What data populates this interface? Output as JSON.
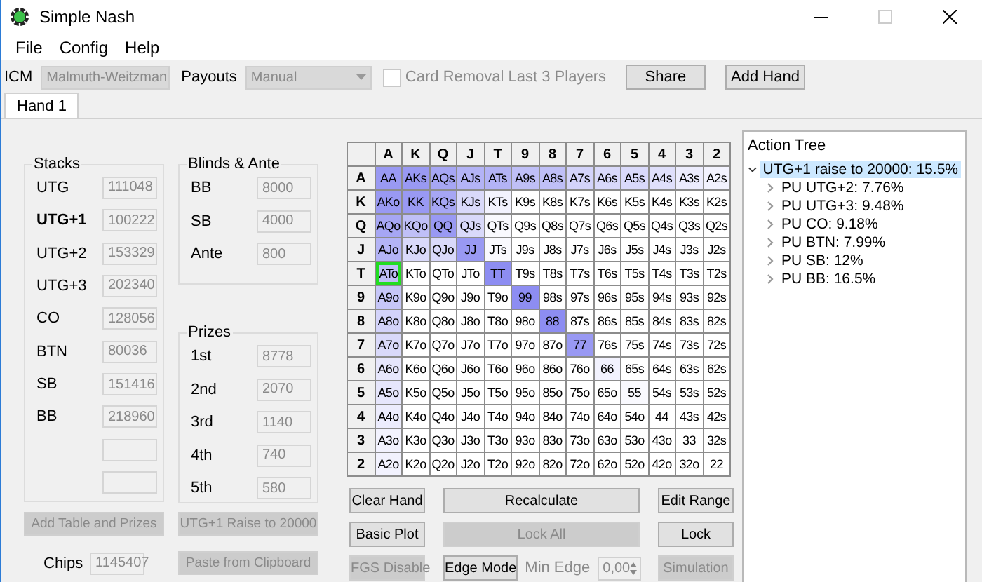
{
  "window": {
    "title": "Simple Nash"
  },
  "menu": [
    "File",
    "Config",
    "Help"
  ],
  "toolbar": {
    "icm_label": "ICM",
    "icm": {
      "value": "Malmuth-Weitzman",
      "disabled": true
    },
    "payouts_label": "Payouts",
    "payouts": {
      "value": "Manual",
      "disabled": true
    },
    "card_removal": {
      "label": "Card Removal Last 3 Players",
      "checked": false,
      "disabled": true
    },
    "buttons": [
      {
        "label": "Share",
        "disabled": false
      },
      {
        "label": "Add Hand",
        "disabled": false
      }
    ]
  },
  "tabs": [
    {
      "label": "Hand 1",
      "selected": true
    }
  ],
  "stacks": {
    "title": "Stacks",
    "rows": [
      {
        "kind": "player",
        "position": "UTG",
        "value": "111048",
        "active": false
      },
      {
        "kind": "player",
        "position": "UTG+1",
        "value": "100222",
        "active": true
      },
      {
        "kind": "player",
        "position": "UTG+2",
        "value": "153329",
        "active": false
      },
      {
        "kind": "player",
        "position": "UTG+3",
        "value": "202340",
        "active": false
      },
      {
        "kind": "player",
        "position": "CO",
        "value": "128056",
        "active": false
      },
      {
        "kind": "player",
        "position": "BTN",
        "value": "80036",
        "active": false
      },
      {
        "kind": "player",
        "position": "SB",
        "value": "151416",
        "active": false
      },
      {
        "kind": "player",
        "position": "BB",
        "value": "218960",
        "active": false
      },
      {
        "kind": "blank"
      },
      {
        "kind": "blank"
      }
    ]
  },
  "blinds": {
    "title": "Blinds & Ante",
    "rows": [
      {
        "label": "BB",
        "value": "8000"
      },
      {
        "label": "SB",
        "value": "4000"
      },
      {
        "label": "Ante",
        "value": "800"
      }
    ]
  },
  "prizes": {
    "title": "Prizes",
    "rows": [
      {
        "label": "1st",
        "value": "8778"
      },
      {
        "label": "2nd",
        "value": "2070"
      },
      {
        "label": "3rd",
        "value": "1140"
      },
      {
        "label": "4th",
        "value": "740"
      },
      {
        "label": "5th",
        "value": "580"
      }
    ]
  },
  "left_buttons": [
    {
      "label": "Add Table and Prizes",
      "disabled": true
    },
    {
      "label": "UTG+1 Raise to 20000",
      "disabled": true
    }
  ],
  "chips": {
    "label": "Chips",
    "value": "1145407"
  },
  "paste_button": {
    "label": "Paste from Clipboard",
    "disabled": true
  },
  "grid": {
    "columns": [
      "A",
      "K",
      "Q",
      "J",
      "T",
      "9",
      "8",
      "7",
      "6",
      "5",
      "4",
      "3",
      "2"
    ],
    "rows": [
      {
        "label": "A",
        "cells": [
          {
            "label": "AA",
            "color": "#9999f3",
            "selected": false
          },
          {
            "label": "AKs",
            "color": "#9999f3",
            "selected": false
          },
          {
            "label": "AQs",
            "color": "#a6a6f4",
            "selected": false
          },
          {
            "label": "AJs",
            "color": "#b3b3f6",
            "selected": false
          },
          {
            "label": "ATs",
            "color": "#b3b3f6",
            "selected": false
          },
          {
            "label": "A9s",
            "color": "#bfbff7",
            "selected": false
          },
          {
            "label": "A8s",
            "color": "#bfbff7",
            "selected": false
          },
          {
            "label": "A7s",
            "color": "#d3d3fa",
            "selected": false
          },
          {
            "label": "A6s",
            "color": "#d9d9fa",
            "selected": false
          },
          {
            "label": "A5s",
            "color": "#d9d9fa",
            "selected": false
          },
          {
            "label": "A4s",
            "color": "#dfdffb",
            "selected": false
          },
          {
            "label": "A3s",
            "color": "#ececfd",
            "selected": false
          },
          {
            "label": "A2s",
            "color": "#f2f2fe",
            "selected": false
          }
        ]
      },
      {
        "label": "K",
        "cells": [
          {
            "label": "AKo",
            "color": "#9999f3",
            "selected": false
          },
          {
            "label": "KK",
            "color": "#9999f3",
            "selected": false
          },
          {
            "label": "KQs",
            "color": "#a6a6f4",
            "selected": false
          },
          {
            "label": "KJs",
            "color": "#d9d9fa",
            "selected": false
          },
          {
            "label": "KTs",
            "color": "#f2f2fe",
            "selected": false
          },
          {
            "label": "K9s",
            "color": "#ffffff",
            "selected": false
          },
          {
            "label": "K8s",
            "color": "#ffffff",
            "selected": false
          },
          {
            "label": "K7s",
            "color": "#ffffff",
            "selected": false
          },
          {
            "label": "K6s",
            "color": "#ffffff",
            "selected": false
          },
          {
            "label": "K5s",
            "color": "#ffffff",
            "selected": false
          },
          {
            "label": "K4s",
            "color": "#ffffff",
            "selected": false
          },
          {
            "label": "K3s",
            "color": "#ffffff",
            "selected": false
          },
          {
            "label": "K2s",
            "color": "#ffffff",
            "selected": false
          }
        ]
      },
      {
        "label": "Q",
        "cells": [
          {
            "label": "AQo",
            "color": "#a6a6f4",
            "selected": false
          },
          {
            "label": "KQo",
            "color": "#bfbff7",
            "selected": false
          },
          {
            "label": "QQ",
            "color": "#9999f3",
            "selected": false
          },
          {
            "label": "QJs",
            "color": "#d9d9fa",
            "selected": false
          },
          {
            "label": "QTs",
            "color": "#f9f9fe",
            "selected": false
          },
          {
            "label": "Q9s",
            "color": "#ffffff",
            "selected": false
          },
          {
            "label": "Q8s",
            "color": "#ffffff",
            "selected": false
          },
          {
            "label": "Q7s",
            "color": "#ffffff",
            "selected": false
          },
          {
            "label": "Q6s",
            "color": "#ffffff",
            "selected": false
          },
          {
            "label": "Q5s",
            "color": "#ffffff",
            "selected": false
          },
          {
            "label": "Q4s",
            "color": "#ffffff",
            "selected": false
          },
          {
            "label": "Q3s",
            "color": "#ffffff",
            "selected": false
          },
          {
            "label": "Q2s",
            "color": "#ffffff",
            "selected": false
          }
        ]
      },
      {
        "label": "J",
        "cells": [
          {
            "label": "AJo",
            "color": "#b3b3f6",
            "selected": false
          },
          {
            "label": "KJo",
            "color": "#d9d9fa",
            "selected": false
          },
          {
            "label": "QJo",
            "color": "#d9d9fa",
            "selected": false
          },
          {
            "label": "JJ",
            "color": "#9999f3",
            "selected": false
          },
          {
            "label": "JTs",
            "color": "#f9f9fe",
            "selected": false
          },
          {
            "label": "J9s",
            "color": "#ffffff",
            "selected": false
          },
          {
            "label": "J8s",
            "color": "#ffffff",
            "selected": false
          },
          {
            "label": "J7s",
            "color": "#ffffff",
            "selected": false
          },
          {
            "label": "J6s",
            "color": "#ffffff",
            "selected": false
          },
          {
            "label": "J5s",
            "color": "#ffffff",
            "selected": false
          },
          {
            "label": "J4s",
            "color": "#ffffff",
            "selected": false
          },
          {
            "label": "J3s",
            "color": "#ffffff",
            "selected": false
          },
          {
            "label": "J2s",
            "color": "#ffffff",
            "selected": false
          }
        ]
      },
      {
        "label": "T",
        "cells": [
          {
            "label": "ATo",
            "color": "#bfbff7",
            "selected": true
          },
          {
            "label": "KTo",
            "color": "#ffffff",
            "selected": false
          },
          {
            "label": "QTo",
            "color": "#ffffff",
            "selected": false
          },
          {
            "label": "JTo",
            "color": "#ffffff",
            "selected": false
          },
          {
            "label": "TT",
            "color": "#8d8df2",
            "selected": false
          },
          {
            "label": "T9s",
            "color": "#ffffff",
            "selected": false
          },
          {
            "label": "T8s",
            "color": "#ffffff",
            "selected": false
          },
          {
            "label": "T7s",
            "color": "#ffffff",
            "selected": false
          },
          {
            "label": "T6s",
            "color": "#ffffff",
            "selected": false
          },
          {
            "label": "T5s",
            "color": "#ffffff",
            "selected": false
          },
          {
            "label": "T4s",
            "color": "#ffffff",
            "selected": false
          },
          {
            "label": "T3s",
            "color": "#ffffff",
            "selected": false
          },
          {
            "label": "T2s",
            "color": "#ffffff",
            "selected": false
          }
        ]
      },
      {
        "label": "9",
        "cells": [
          {
            "label": "A9o",
            "color": "#c6c6f8",
            "selected": false
          },
          {
            "label": "K9o",
            "color": "#ffffff",
            "selected": false
          },
          {
            "label": "Q9o",
            "color": "#ffffff",
            "selected": false
          },
          {
            "label": "J9o",
            "color": "#ffffff",
            "selected": false
          },
          {
            "label": "T9o",
            "color": "#ffffff",
            "selected": false
          },
          {
            "label": "99",
            "color": "#8d8df2",
            "selected": false
          },
          {
            "label": "98s",
            "color": "#ffffff",
            "selected": false
          },
          {
            "label": "97s",
            "color": "#ffffff",
            "selected": false
          },
          {
            "label": "96s",
            "color": "#ffffff",
            "selected": false
          },
          {
            "label": "95s",
            "color": "#ffffff",
            "selected": false
          },
          {
            "label": "94s",
            "color": "#ffffff",
            "selected": false
          },
          {
            "label": "93s",
            "color": "#ffffff",
            "selected": false
          },
          {
            "label": "92s",
            "color": "#ffffff",
            "selected": false
          }
        ]
      },
      {
        "label": "8",
        "cells": [
          {
            "label": "A8o",
            "color": "#d3d3fa",
            "selected": false
          },
          {
            "label": "K8o",
            "color": "#ffffff",
            "selected": false
          },
          {
            "label": "Q8o",
            "color": "#ffffff",
            "selected": false
          },
          {
            "label": "J8o",
            "color": "#ffffff",
            "selected": false
          },
          {
            "label": "T8o",
            "color": "#ffffff",
            "selected": false
          },
          {
            "label": "98o",
            "color": "#ffffff",
            "selected": false
          },
          {
            "label": "88",
            "color": "#8d8df2",
            "selected": false
          },
          {
            "label": "87s",
            "color": "#ffffff",
            "selected": false
          },
          {
            "label": "86s",
            "color": "#ffffff",
            "selected": false
          },
          {
            "label": "85s",
            "color": "#ffffff",
            "selected": false
          },
          {
            "label": "84s",
            "color": "#ffffff",
            "selected": false
          },
          {
            "label": "83s",
            "color": "#ffffff",
            "selected": false
          },
          {
            "label": "82s",
            "color": "#ffffff",
            "selected": false
          }
        ]
      },
      {
        "label": "7",
        "cells": [
          {
            "label": "A7o",
            "color": "#d9d9fa",
            "selected": false
          },
          {
            "label": "K7o",
            "color": "#ffffff",
            "selected": false
          },
          {
            "label": "Q7o",
            "color": "#ffffff",
            "selected": false
          },
          {
            "label": "J7o",
            "color": "#ffffff",
            "selected": false
          },
          {
            "label": "T7o",
            "color": "#ffffff",
            "selected": false
          },
          {
            "label": "97o",
            "color": "#ffffff",
            "selected": false
          },
          {
            "label": "87o",
            "color": "#ffffff",
            "selected": false
          },
          {
            "label": "77",
            "color": "#9999f3",
            "selected": false
          },
          {
            "label": "76s",
            "color": "#ffffff",
            "selected": false
          },
          {
            "label": "75s",
            "color": "#ffffff",
            "selected": false
          },
          {
            "label": "74s",
            "color": "#ffffff",
            "selected": false
          },
          {
            "label": "73s",
            "color": "#ffffff",
            "selected": false
          },
          {
            "label": "72s",
            "color": "#ffffff",
            "selected": false
          }
        ]
      },
      {
        "label": "6",
        "cells": [
          {
            "label": "A6o",
            "color": "#e6e6fc",
            "selected": false
          },
          {
            "label": "K6o",
            "color": "#ffffff",
            "selected": false
          },
          {
            "label": "Q6o",
            "color": "#ffffff",
            "selected": false
          },
          {
            "label": "J6o",
            "color": "#ffffff",
            "selected": false
          },
          {
            "label": "T6o",
            "color": "#ffffff",
            "selected": false
          },
          {
            "label": "96o",
            "color": "#ffffff",
            "selected": false
          },
          {
            "label": "86o",
            "color": "#ffffff",
            "selected": false
          },
          {
            "label": "76o",
            "color": "#ffffff",
            "selected": false
          },
          {
            "label": "66",
            "color": "#f2f2fe",
            "selected": false
          },
          {
            "label": "65s",
            "color": "#ffffff",
            "selected": false
          },
          {
            "label": "64s",
            "color": "#ffffff",
            "selected": false
          },
          {
            "label": "63s",
            "color": "#ffffff",
            "selected": false
          },
          {
            "label": "62s",
            "color": "#ffffff",
            "selected": false
          }
        ]
      },
      {
        "label": "5",
        "cells": [
          {
            "label": "A5o",
            "color": "#e6e6fc",
            "selected": false
          },
          {
            "label": "K5o",
            "color": "#ffffff",
            "selected": false
          },
          {
            "label": "Q5o",
            "color": "#ffffff",
            "selected": false
          },
          {
            "label": "J5o",
            "color": "#ffffff",
            "selected": false
          },
          {
            "label": "T5o",
            "color": "#ffffff",
            "selected": false
          },
          {
            "label": "95o",
            "color": "#ffffff",
            "selected": false
          },
          {
            "label": "85o",
            "color": "#ffffff",
            "selected": false
          },
          {
            "label": "75o",
            "color": "#ffffff",
            "selected": false
          },
          {
            "label": "65o",
            "color": "#ffffff",
            "selected": false
          },
          {
            "label": "55",
            "color": "#f9f9fe",
            "selected": false
          },
          {
            "label": "54s",
            "color": "#ffffff",
            "selected": false
          },
          {
            "label": "53s",
            "color": "#ffffff",
            "selected": false
          },
          {
            "label": "52s",
            "color": "#ffffff",
            "selected": false
          }
        ]
      },
      {
        "label": "4",
        "cells": [
          {
            "label": "A4o",
            "color": "#ececfd",
            "selected": false
          },
          {
            "label": "K4o",
            "color": "#ffffff",
            "selected": false
          },
          {
            "label": "Q4o",
            "color": "#ffffff",
            "selected": false
          },
          {
            "label": "J4o",
            "color": "#ffffff",
            "selected": false
          },
          {
            "label": "T4o",
            "color": "#ffffff",
            "selected": false
          },
          {
            "label": "94o",
            "color": "#ffffff",
            "selected": false
          },
          {
            "label": "84o",
            "color": "#ffffff",
            "selected": false
          },
          {
            "label": "74o",
            "color": "#ffffff",
            "selected": false
          },
          {
            "label": "64o",
            "color": "#ffffff",
            "selected": false
          },
          {
            "label": "54o",
            "color": "#ffffff",
            "selected": false
          },
          {
            "label": "44",
            "color": "#ffffff",
            "selected": false
          },
          {
            "label": "43s",
            "color": "#ffffff",
            "selected": false
          },
          {
            "label": "42s",
            "color": "#ffffff",
            "selected": false
          }
        ]
      },
      {
        "label": "3",
        "cells": [
          {
            "label": "A3o",
            "color": "#f2f2fe",
            "selected": false
          },
          {
            "label": "K3o",
            "color": "#ffffff",
            "selected": false
          },
          {
            "label": "Q3o",
            "color": "#ffffff",
            "selected": false
          },
          {
            "label": "J3o",
            "color": "#ffffff",
            "selected": false
          },
          {
            "label": "T3o",
            "color": "#ffffff",
            "selected": false
          },
          {
            "label": "93o",
            "color": "#ffffff",
            "selected": false
          },
          {
            "label": "83o",
            "color": "#ffffff",
            "selected": false
          },
          {
            "label": "73o",
            "color": "#ffffff",
            "selected": false
          },
          {
            "label": "63o",
            "color": "#ffffff",
            "selected": false
          },
          {
            "label": "53o",
            "color": "#ffffff",
            "selected": false
          },
          {
            "label": "43o",
            "color": "#ffffff",
            "selected": false
          },
          {
            "label": "33",
            "color": "#ffffff",
            "selected": false
          },
          {
            "label": "32s",
            "color": "#ffffff",
            "selected": false
          }
        ]
      },
      {
        "label": "2",
        "cells": [
          {
            "label": "A2o",
            "color": "#f2f2fe",
            "selected": false
          },
          {
            "label": "K2o",
            "color": "#ffffff",
            "selected": false
          },
          {
            "label": "Q2o",
            "color": "#ffffff",
            "selected": false
          },
          {
            "label": "J2o",
            "color": "#ffffff",
            "selected": false
          },
          {
            "label": "T2o",
            "color": "#ffffff",
            "selected": false
          },
          {
            "label": "92o",
            "color": "#ffffff",
            "selected": false
          },
          {
            "label": "82o",
            "color": "#ffffff",
            "selected": false
          },
          {
            "label": "72o",
            "color": "#ffffff",
            "selected": false
          },
          {
            "label": "62o",
            "color": "#ffffff",
            "selected": false
          },
          {
            "label": "52o",
            "color": "#ffffff",
            "selected": false
          },
          {
            "label": "42o",
            "color": "#ffffff",
            "selected": false
          },
          {
            "label": "32o",
            "color": "#ffffff",
            "selected": false
          },
          {
            "label": "22",
            "color": "#ffffff",
            "selected": false
          }
        ]
      }
    ]
  },
  "grid_controls": [
    {
      "kind": "button",
      "label": "Clear Hand",
      "disabled": false
    },
    {
      "kind": "button",
      "label": "Recalculate",
      "disabled": false
    },
    {
      "kind": "button",
      "label": "Edit Range",
      "disabled": false
    },
    {
      "kind": "button",
      "label": "Basic Plot",
      "disabled": false
    },
    {
      "kind": "button",
      "label": "Lock All",
      "disabled": true
    },
    {
      "kind": "button",
      "label": "Lock",
      "disabled": false
    },
    {
      "kind": "button",
      "label": "FGS Disable",
      "disabled": true
    },
    {
      "kind": "edge",
      "label": "Edge Mode",
      "disabled": false,
      "min_label": "Min Edge",
      "min_value": "0,00",
      "min_disabled": true
    },
    {
      "kind": "button",
      "label": "Simulation",
      "disabled": true
    }
  ],
  "action_tree": {
    "title": "Action Tree",
    "nodes": [
      {
        "label": "UTG+1 raise to 20000: 15.5%",
        "expanded": true,
        "selected": true,
        "children": [
          {
            "label": "PU UTG+2: 7.76%",
            "expanded": false,
            "selected": false
          },
          {
            "label": "PU UTG+3: 9.48%",
            "expanded": false,
            "selected": false
          },
          {
            "label": "PU CO: 9.18%",
            "expanded": false,
            "selected": false
          },
          {
            "label": "PU BTN: 7.99%",
            "expanded": false,
            "selected": false
          },
          {
            "label": "PU SB: 12%",
            "expanded": false,
            "selected": false
          },
          {
            "label": "PU BB: 16.5%",
            "expanded": false,
            "selected": false
          }
        ]
      }
    ]
  }
}
